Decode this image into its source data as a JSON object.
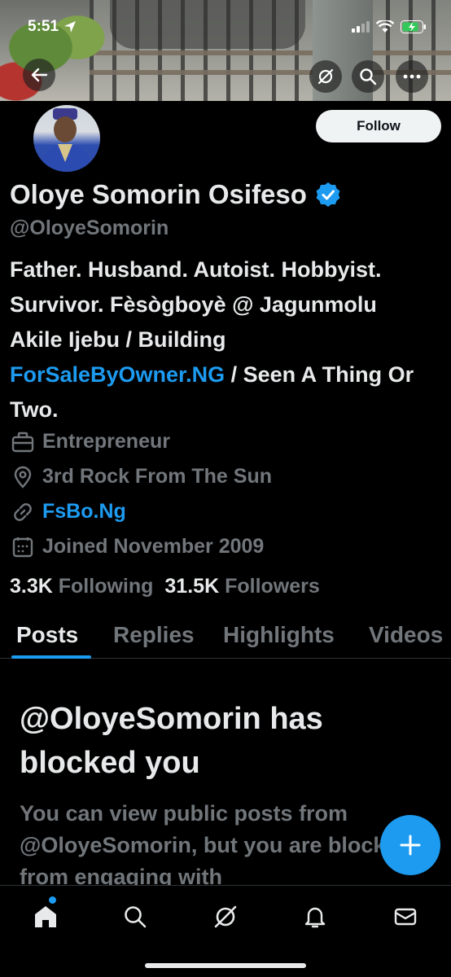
{
  "status_bar": {
    "time": "5:51"
  },
  "profile": {
    "name": "Oloye Somorin Osifeso",
    "handle": "@OloyeSomorin",
    "follow_label": "Follow",
    "bio": {
      "part1": "Father. Husband. Autoist. Hobbyist. Survivor. Fèsògboyè @ Jagunmolu Akile Ijebu / Building ",
      "link": "ForSaleByOwner.NG",
      "part2": " / Seen A Thing Or Two."
    },
    "occupation": "Entrepreneur",
    "location": "3rd Rock From The Sun",
    "website": "FsBo.Ng",
    "joined": "Joined November 2009",
    "following_count": "3.3K",
    "following_label": "Following",
    "followers_count": "31.5K",
    "followers_label": "Followers"
  },
  "tabs": [
    "Posts",
    "Replies",
    "Highlights",
    "Videos"
  ],
  "blocked": {
    "title": "@OloyeSomorin has blocked you",
    "body": "You can view public posts from @OloyeSomorin, but you are blocked from engaging with"
  },
  "colors": {
    "accent": "#1d9bf0",
    "background": "#000000",
    "muted": "#71767b"
  },
  "icons": [
    "back-arrow-icon",
    "grok-icon",
    "search-icon",
    "more-icon",
    "verified-badge-icon",
    "briefcase-icon",
    "location-pin-icon",
    "link-icon",
    "calendar-icon",
    "plus-icon",
    "home-icon",
    "bell-icon",
    "mail-icon"
  ]
}
